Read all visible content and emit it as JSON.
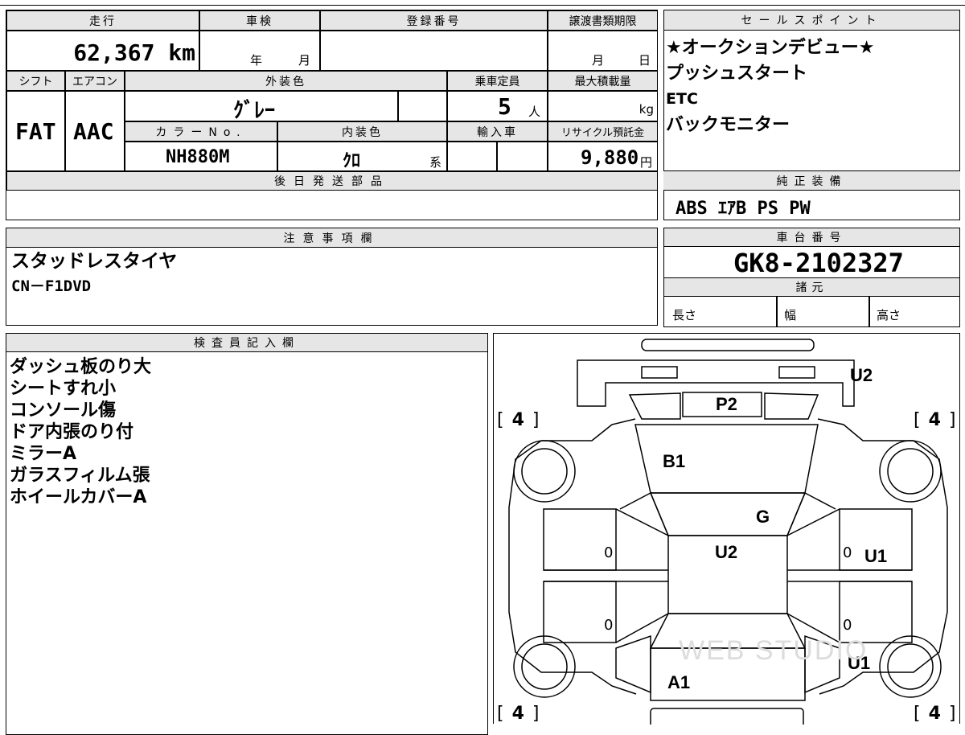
{
  "mileage": {
    "label": "走行",
    "value": "62,367 km"
  },
  "inspection": {
    "label": "車検",
    "year_unit": "年",
    "month_unit": "月"
  },
  "registration": {
    "label": "登録番号"
  },
  "transfer": {
    "label": "譲渡書類期限",
    "month_unit": "月",
    "day_unit": "日"
  },
  "shift": {
    "label": "シフト",
    "value": "FAT"
  },
  "aircon": {
    "label": "エアコン",
    "value": "AAC"
  },
  "exterior": {
    "label": "外装色",
    "value": "ｸﾞﾚｰ"
  },
  "capacity": {
    "label": "乗車定員",
    "value": "5",
    "unit": "人"
  },
  "max_load": {
    "label": "最大積載量",
    "unit": "kg"
  },
  "color_no": {
    "label": "カラーNo.",
    "value": "NH880M"
  },
  "interior": {
    "label": "内装色",
    "value": "ｸﾛ",
    "suffix": "系"
  },
  "import": {
    "label": "輸入車"
  },
  "recycle": {
    "label": "リサイクル預託金",
    "value": "9,880",
    "unit": "円"
  },
  "later_parts": {
    "label": "後日発送部品",
    "value": ""
  },
  "sales_points": {
    "label": "セールスポイント",
    "items": [
      "★オークションデビュー★",
      "プッシュスタート",
      "ETC",
      "バックモニター"
    ]
  },
  "standard_equipment": {
    "label": "純正装備",
    "value": "ABS ｴｱB PS PW"
  },
  "notes": {
    "label": "注意事項欄",
    "lines": [
      "スタッドレスタイヤ",
      "CN－F1DVD"
    ]
  },
  "chassis": {
    "label": "車台番号",
    "value": "GK8-2102327"
  },
  "dimensions": {
    "label": "諸元",
    "length": "長さ",
    "width": "幅",
    "height": "高さ"
  },
  "inspector": {
    "label": "検査員記入欄",
    "lines": [
      "ダッシュ板のり大",
      "シートすれ小",
      "コンソール傷",
      "ドア内張のり付",
      "ミラーA",
      "ガラスフィルム張",
      "ホイールカバーA"
    ]
  },
  "diagram": {
    "marks": {
      "u2_top": "U2",
      "p2": "P2",
      "b1": "B1",
      "g": "G",
      "u2_roof": "U2",
      "u1_front": "U1",
      "u1_rear": "U1",
      "a1": "A1"
    },
    "tire_depth": "4",
    "bracket_left": "[",
    "bracket_right": "]",
    "door_zero": "0"
  },
  "watermark": "WEB STUDIO"
}
